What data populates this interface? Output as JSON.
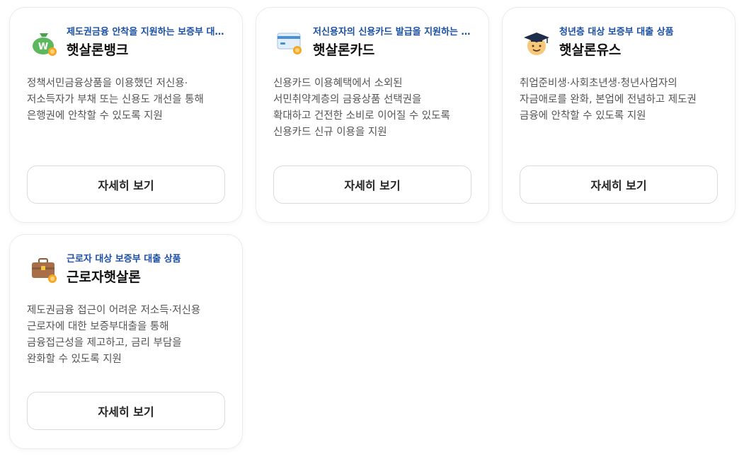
{
  "cards": [
    {
      "subtitle": "제도권금융 안착을 지원하는 보증부 대출 상품",
      "title": "햇살론뱅크",
      "description": [
        "정책서민금융상품을 이용했던 저신용·",
        "저소득자가 부채 또는 신용도 개선을 통해",
        "은행권에 안착할 수 있도록 지원"
      ],
      "button": "자세히 보기",
      "icon": "money-bag-icon"
    },
    {
      "subtitle": "저신용자의 신용카드 발급을 지원하는 보증 상품",
      "title": "햇살론카드",
      "description": [
        "신용카드 이용혜택에서 소외된",
        "서민취약계층의 금융상품 선택권을",
        "확대하고 건전한 소비로 이어질 수 있도록",
        "신용카드 신규 이용을 지원"
      ],
      "button": "자세히 보기",
      "icon": "credit-card-icon"
    },
    {
      "subtitle": "청년층 대상 보증부 대출 상품",
      "title": "햇살론유스",
      "description": [
        "취업준비생·사회초년생·청년사업자의",
        "자금애로를 완화, 본업에 전념하고 제도권",
        "금융에 안착할 수 있도록 지원"
      ],
      "button": "자세히 보기",
      "icon": "graduation-cap-icon"
    },
    {
      "subtitle": "근로자 대상 보증부 대출 상품",
      "title": "근로자햇살론",
      "description": [
        "제도권금융 접근이 어려운 저소득·저신용",
        "근로자에 대한 보증부대출을 통해",
        "금융접근성을 제고하고, 금리 부담을",
        "완화할 수 있도록 지원"
      ],
      "button": "자세히 보기",
      "icon": "briefcase-icon"
    }
  ],
  "colors": {
    "subtitle": "#1a4fa6",
    "sun_badge": "#f5a623",
    "bag_green": "#5bb85c"
  }
}
